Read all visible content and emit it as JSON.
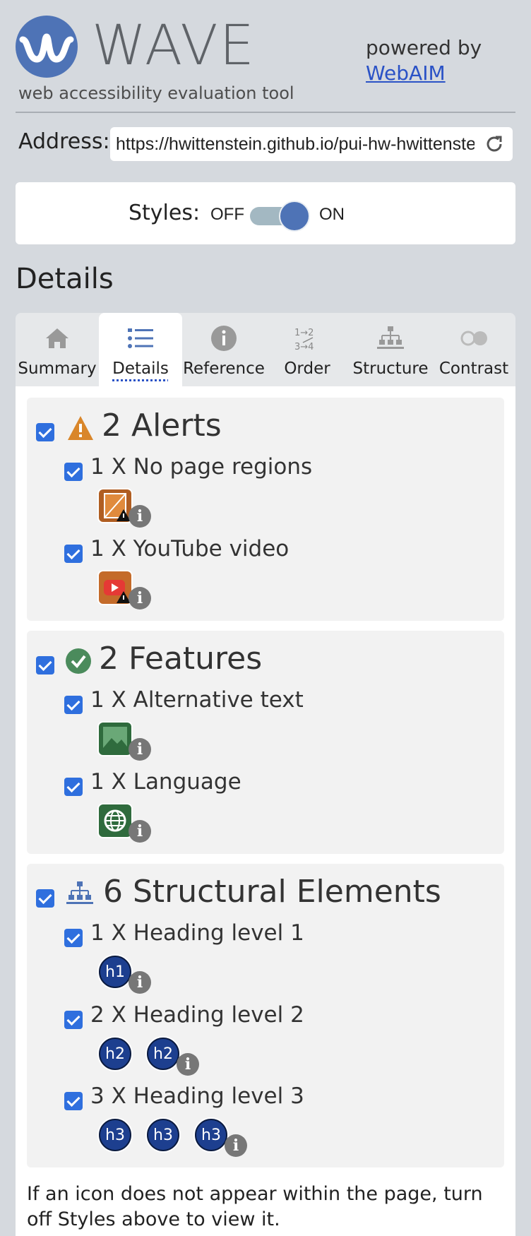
{
  "header": {
    "logo_text": "WAVE",
    "tagline": "web accessibility evaluation tool",
    "powered_by": "powered by",
    "webaim_link": "WebAIM"
  },
  "address": {
    "label": "Address:",
    "value": "https://hwittenstein.github.io/pui-hw-hwittenstein"
  },
  "styles": {
    "label": "Styles:",
    "off": "OFF",
    "on": "ON",
    "enabled": true
  },
  "details_title": "Details",
  "tabs": [
    {
      "label": "Summary",
      "icon": "home-icon"
    },
    {
      "label": "Details",
      "icon": "list-icon",
      "active": true
    },
    {
      "label": "Reference",
      "icon": "info-icon"
    },
    {
      "label": "Order",
      "icon": "order-icon"
    },
    {
      "label": "Structure",
      "icon": "structure-icon"
    },
    {
      "label": "Contrast",
      "icon": "contrast-icon"
    }
  ],
  "sections": {
    "alerts": {
      "title": "2 Alerts",
      "items": [
        {
          "label": "1 X No page regions",
          "icon": "no-page-regions-icon"
        },
        {
          "label": "1 X YouTube video",
          "icon": "youtube-video-icon"
        }
      ]
    },
    "features": {
      "title": "2 Features",
      "items": [
        {
          "label": "1 X Alternative text",
          "icon": "alternative-text-icon"
        },
        {
          "label": "1 X Language",
          "icon": "language-icon"
        }
      ]
    },
    "structural": {
      "title": "6 Structural Elements",
      "items": [
        {
          "label": "1 X Heading level 1",
          "badges": [
            "h1"
          ]
        },
        {
          "label": "2 X Heading level 2",
          "badges": [
            "h2",
            "h2"
          ]
        },
        {
          "label": "3 X Heading level 3",
          "badges": [
            "h3",
            "h3",
            "h3"
          ]
        }
      ]
    }
  },
  "info_glyph": "i",
  "footer_note": "If an icon does not appear within the page, turn off Styles above to view it.",
  "colors": {
    "accent": "#4e73b6",
    "checkbox": "#2f6fde",
    "alert": "#d9862a",
    "feature": "#4b8b5c",
    "heading_badge": "#1d3f8f"
  }
}
